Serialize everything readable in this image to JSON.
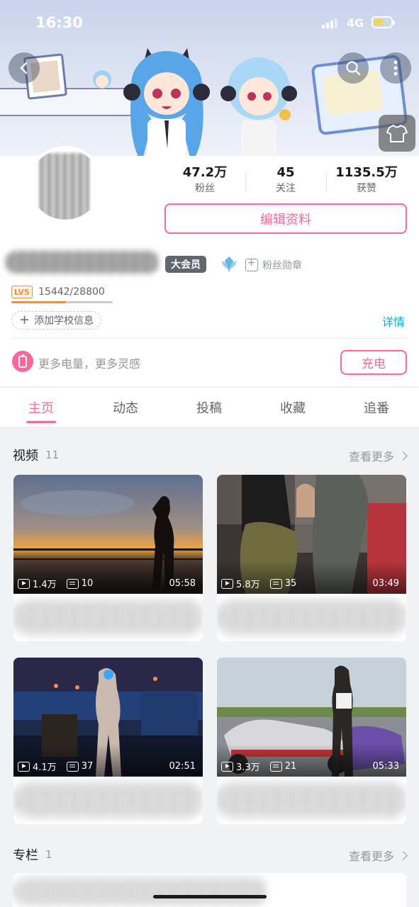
{
  "status_bar": {
    "time": "16:30",
    "network": "4G"
  },
  "profile": {
    "stats": [
      {
        "value": "47.2万",
        "label": "粉丝"
      },
      {
        "value": "45",
        "label": "关注"
      },
      {
        "value": "1135.5万",
        "label": "获赞"
      }
    ],
    "edit_label": "编辑资料",
    "vip_badge": "大会员",
    "fan_medal_label": "粉丝勋章",
    "level": "LV5",
    "exp_text": "15442/28800",
    "exp_progress": 0.536,
    "school_label": "添加学校信息",
    "details_label": "详情",
    "charge_prompt": "更多电量，更多灵感",
    "charge_label": "充电"
  },
  "tabs": [
    {
      "label": "主页",
      "active": true
    },
    {
      "label": "动态",
      "active": false
    },
    {
      "label": "投稿",
      "active": false
    },
    {
      "label": "收藏",
      "active": false
    },
    {
      "label": "追番",
      "active": false
    }
  ],
  "videos_section": {
    "title": "视频",
    "count": "11",
    "more_label": "查看更多",
    "items": [
      {
        "plays": "1.4万",
        "danmaku": "10",
        "duration": "05:58",
        "scene": "sunset-rooftop"
      },
      {
        "plays": "5.8万",
        "danmaku": "35",
        "duration": "03:49",
        "scene": "gym"
      },
      {
        "plays": "4.1万",
        "danmaku": "37",
        "duration": "02:51",
        "scene": "night-gym"
      },
      {
        "plays": "3.3万",
        "danmaku": "21",
        "duration": "05:33",
        "scene": "go-kart-track"
      }
    ]
  },
  "articles_section": {
    "title": "专栏",
    "count": "1",
    "more_label": "查看更多"
  },
  "colors": {
    "accent": "#ff6699",
    "link": "#00aeec",
    "level": "#ff8a33",
    "text_secondary": "#9499a0"
  },
  "icons": [
    "back-icon",
    "search-icon",
    "more-icon",
    "shirt-icon",
    "charge-icon",
    "play-count-icon",
    "danmaku-icon",
    "chevron-right-icon",
    "crest-icon"
  ]
}
